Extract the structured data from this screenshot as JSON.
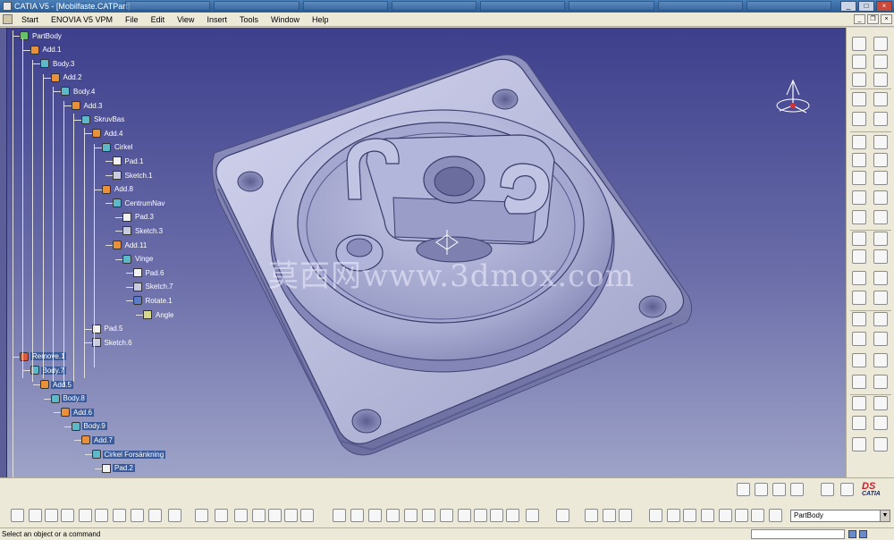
{
  "window": {
    "title": "CATIA V5 - [Mobilfaste.CATPart]"
  },
  "menu": {
    "items": [
      "Start",
      "ENOVIA V5 VPM",
      "File",
      "Edit",
      "View",
      "Insert",
      "Tools",
      "Window",
      "Help"
    ]
  },
  "tree": {
    "nodes": [
      {
        "label": "PartBody",
        "icon": "part-body-icon",
        "kind": "part"
      },
      {
        "label": "Add.1",
        "icon": "add-icon",
        "kind": "add"
      },
      {
        "label": "Body.3",
        "icon": "body-icon",
        "kind": "body"
      },
      {
        "label": "Add.2",
        "icon": "add-icon",
        "kind": "add"
      },
      {
        "label": "Body.4",
        "icon": "body-icon",
        "kind": "body"
      },
      {
        "label": "Add.3",
        "icon": "add-icon",
        "kind": "add"
      },
      {
        "label": "SkruvBas",
        "icon": "body-icon",
        "kind": "body"
      },
      {
        "label": "Add.4",
        "icon": "add-icon",
        "kind": "add"
      },
      {
        "label": "Cirkel",
        "icon": "body-icon",
        "kind": "body"
      },
      {
        "label": "Pad.1",
        "icon": "pad-icon",
        "kind": "pad"
      },
      {
        "label": "Sketch.1",
        "icon": "sketch-icon",
        "kind": "sketch"
      },
      {
        "label": "Add.8",
        "icon": "add-icon",
        "kind": "add"
      },
      {
        "label": "CentrumNav",
        "icon": "body-icon",
        "kind": "body"
      },
      {
        "label": "Pad.3",
        "icon": "pad-icon",
        "kind": "pad"
      },
      {
        "label": "Sketch.3",
        "icon": "sketch-icon",
        "kind": "sketch"
      },
      {
        "label": "Add.11",
        "icon": "add-icon",
        "kind": "add"
      },
      {
        "label": "Vinge",
        "icon": "body-icon",
        "kind": "body"
      },
      {
        "label": "Pad.6",
        "icon": "pad-icon",
        "kind": "pad"
      },
      {
        "label": "Sketch.7",
        "icon": "sketch-icon",
        "kind": "sketch"
      },
      {
        "label": "Rotate.1",
        "icon": "rotate-icon",
        "kind": "shaft"
      },
      {
        "label": "Angle",
        "icon": "angle-icon",
        "kind": "angle"
      },
      {
        "label": "Pad.5",
        "icon": "pad-icon",
        "kind": "pad"
      },
      {
        "label": "Sketch.6",
        "icon": "sketch-icon",
        "kind": "sketch"
      },
      {
        "label": "Remove.1",
        "icon": "remove-icon",
        "kind": "remove"
      },
      {
        "label": "Body.7",
        "icon": "body-icon",
        "kind": "body"
      },
      {
        "label": "Add.5",
        "icon": "add-icon",
        "kind": "add"
      },
      {
        "label": "Body.8",
        "icon": "body-icon",
        "kind": "body"
      },
      {
        "label": "Add.6",
        "icon": "add-icon",
        "kind": "add"
      },
      {
        "label": "Body.9",
        "icon": "body-icon",
        "kind": "body"
      },
      {
        "label": "Add.7",
        "icon": "add-icon",
        "kind": "add"
      },
      {
        "label": "Cirkel Forsänkning",
        "icon": "body-icon",
        "kind": "body"
      },
      {
        "label": "Pad.2",
        "icon": "pad-icon",
        "kind": "pad"
      }
    ]
  },
  "watermark": "莫西网www.3dmox.com",
  "part_selector": {
    "value": "PartBody"
  },
  "status": {
    "message": "Select an object or a command"
  },
  "logo": {
    "brand": "CATIA",
    "mark": "DS"
  },
  "colors": {
    "viewport_top": "#3d3f8c",
    "viewport_bottom": "#9ea3c8",
    "model": "#b8bbdc",
    "tree_highlight": "#3a5a9a"
  }
}
